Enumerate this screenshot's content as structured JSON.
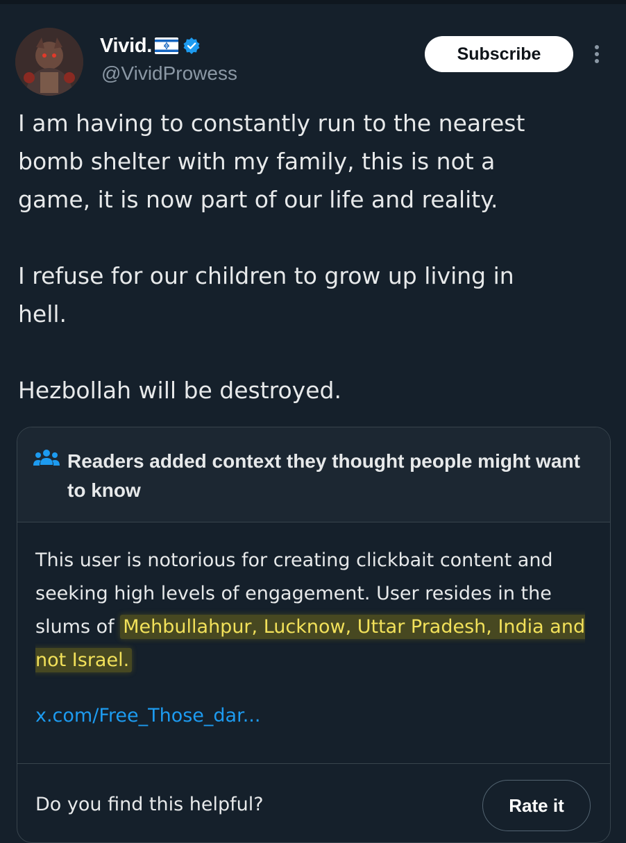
{
  "author": {
    "display_name": "Vivid.",
    "handle": "@VividProwess",
    "flag_icon": "israel-flag-icon",
    "verified_icon": "verified-badge-icon"
  },
  "actions": {
    "subscribe_label": "Subscribe",
    "more_icon": "more-vertical-icon"
  },
  "tweet": {
    "paragraphs": [
      "I am having to constantly run to the nearest\nbomb shelter with my family, this is not a\ngame, it is now part of our life and reality.",
      "I refuse for our children to grow up living in\nhell.",
      "Hezbollah will be destroyed."
    ]
  },
  "community_note": {
    "icon": "people-icon",
    "title": "Readers added context they thought people might want to know",
    "body_plain": "This user is notorious for creating clickbait content and seeking high levels of engagement. User resides in the slums of ",
    "body_highlight": "Mehbullahpur, Lucknow, Uttar Pradesh, India and not Israel.",
    "link_text": "x.com/Free_Those_dar...",
    "helpful_question": "Do you find this helpful?",
    "rate_label": "Rate it"
  },
  "colors": {
    "background": "#15202b",
    "text": "#e7e9ea",
    "muted": "#8b98a5",
    "link": "#1d9bf0",
    "highlight": "#f2e15a",
    "verified": "#1d9bf0"
  }
}
